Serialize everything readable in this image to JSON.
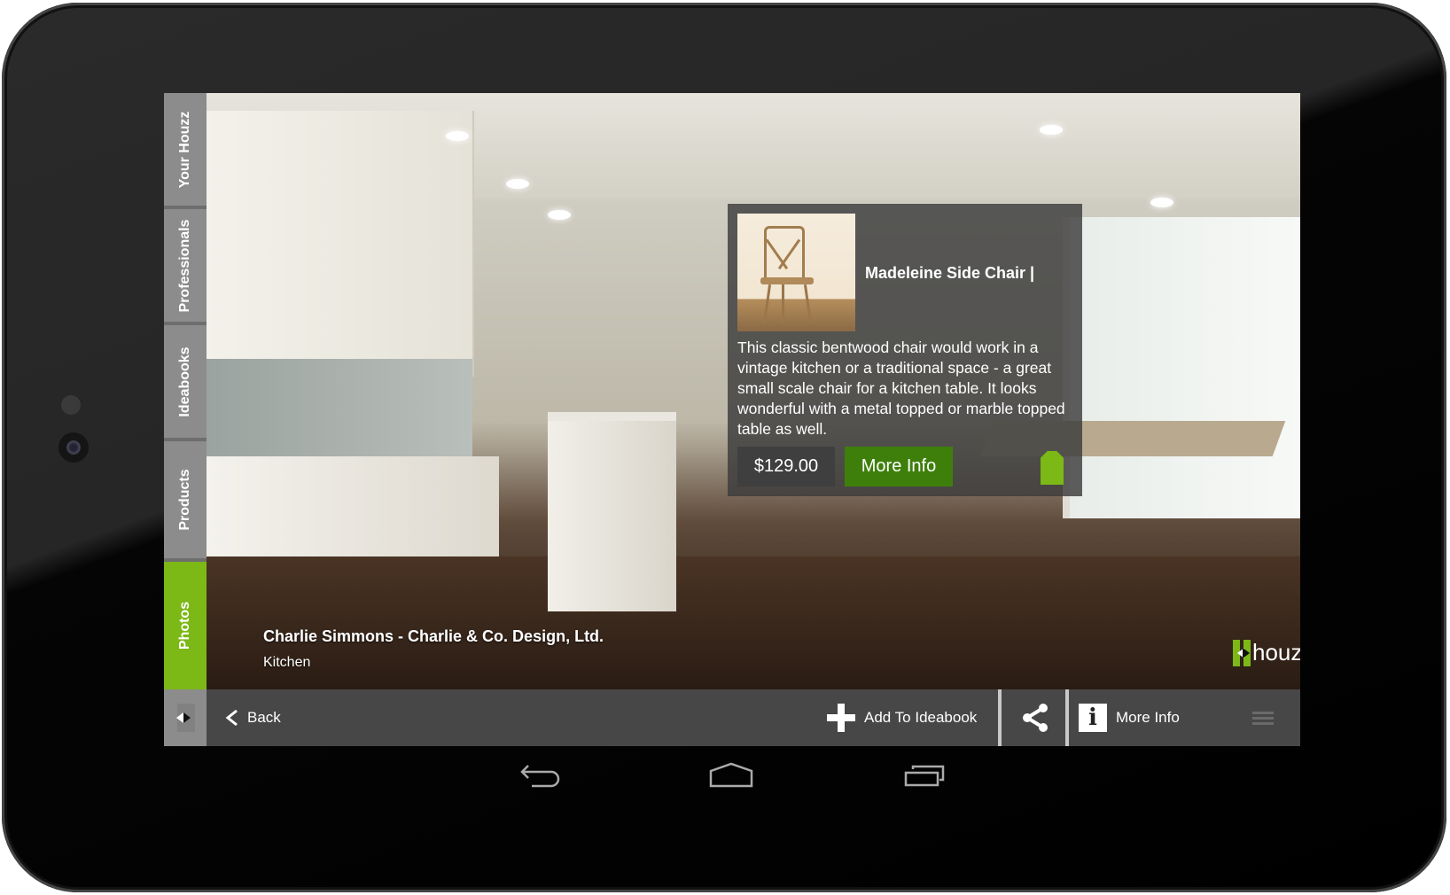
{
  "app": {
    "name": "houzz",
    "brand_color": "#7cb816",
    "button_green": "#3e7f0c"
  },
  "sidebar": {
    "tabs": [
      {
        "label": "Your Houzz",
        "active": false
      },
      {
        "label": "Professionals",
        "active": false
      },
      {
        "label": "Ideabooks",
        "active": false
      },
      {
        "label": "Products",
        "active": false
      },
      {
        "label": "Photos",
        "active": true
      }
    ],
    "collapse_icon": "collapse-arrows-icon"
  },
  "photo": {
    "author": "Charlie Simmons - Charlie & Co. Design, Ltd.",
    "room": "Kitchen",
    "logo_text": "houzz"
  },
  "product_popup": {
    "name": "Madeleine Side Chair |",
    "description": "This classic bentwood chair would work in a vintage kitchen or a traditional space - a great small scale chair for a kitchen table. It looks wonderful with a metal topped or marble topped table as well.",
    "price": "$129.00",
    "more_info_label": "More Info",
    "tag_icon": "price-tag-icon"
  },
  "bottom_bar": {
    "back_label": "Back",
    "add_label": "Add To Ideabook",
    "share_icon": "share-icon",
    "more_info_label": "More Info",
    "menu_icon": "menu-icon"
  },
  "system_nav": {
    "back": "back-icon",
    "home": "home-icon",
    "recents": "recent-apps-icon"
  }
}
